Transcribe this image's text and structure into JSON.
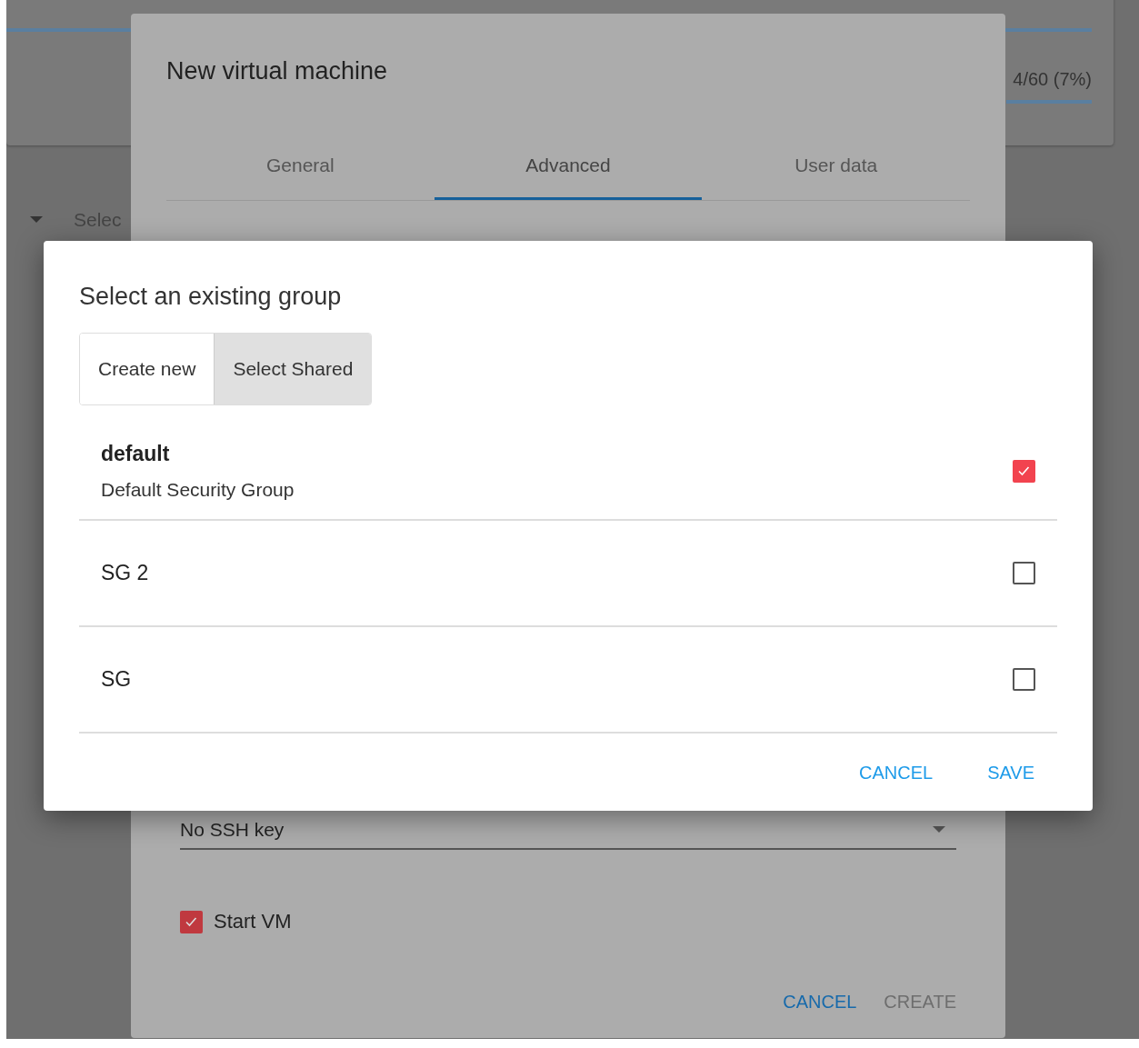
{
  "background": {
    "usage_label": "4/60 (7%)",
    "select_label": "Selec"
  },
  "vm_dialog": {
    "title": "New virtual machine",
    "tabs": [
      {
        "label": "General",
        "selected": false
      },
      {
        "label": "Advanced",
        "selected": true
      },
      {
        "label": "User data",
        "selected": false
      }
    ],
    "ssh_key": {
      "value": "No SSH key"
    },
    "start_vm": {
      "label": "Start VM",
      "checked": true
    },
    "buttons": [
      {
        "label": "CANCEL",
        "disabled": false
      },
      {
        "label": "CREATE",
        "disabled": true
      }
    ]
  },
  "group_dialog": {
    "title": "Select an existing group",
    "modes": [
      {
        "label": "Create new",
        "selected": false
      },
      {
        "label": "Select Shared",
        "selected": true
      }
    ],
    "groups": [
      {
        "name": "default",
        "description": "Default Security Group",
        "checked": true
      },
      {
        "name": "SG 2",
        "checked": false
      },
      {
        "name": "SG",
        "checked": false
      }
    ],
    "buttons": [
      "CANCEL",
      "SAVE"
    ]
  }
}
